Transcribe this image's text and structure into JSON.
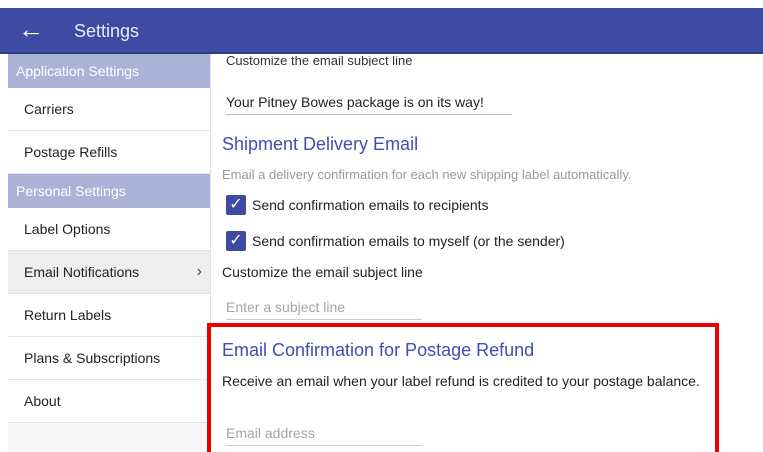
{
  "header": {
    "title": "Settings",
    "back_icon": "arrow-left-icon"
  },
  "sidebar": {
    "sections": [
      {
        "header": "Application Settings",
        "items": [
          "Carriers",
          "Postage Refills"
        ]
      },
      {
        "header": "Personal Settings",
        "items": [
          "Label Options",
          "Email Notifications",
          "Return Labels",
          "Plans & Subscriptions",
          "About"
        ]
      }
    ],
    "active_item": "Email Notifications",
    "chevron": "›"
  },
  "main": {
    "cut_label": "Customize the email subject line",
    "subject_value": "Your Pitney Bowes package is on its way!",
    "shipment_delivery": {
      "title": "Shipment Delivery Email",
      "description": "Email a delivery confirmation for each new shipping label automatically.",
      "checkbox_recipients": "Send confirmation emails to recipients",
      "checkbox_myself": "Send confirmation emails to myself (or the sender)",
      "subject_label": "Customize the email subject line",
      "subject_placeholder": "Enter a subject line"
    },
    "postage_refund": {
      "title": "Email Confirmation for Postage Refund",
      "description": "Receive an email when your label refund is credited to your postage balance.",
      "email_placeholder": "Email address"
    }
  },
  "colors": {
    "accent": "#3e4ba3",
    "highlight": "#ee0000"
  }
}
